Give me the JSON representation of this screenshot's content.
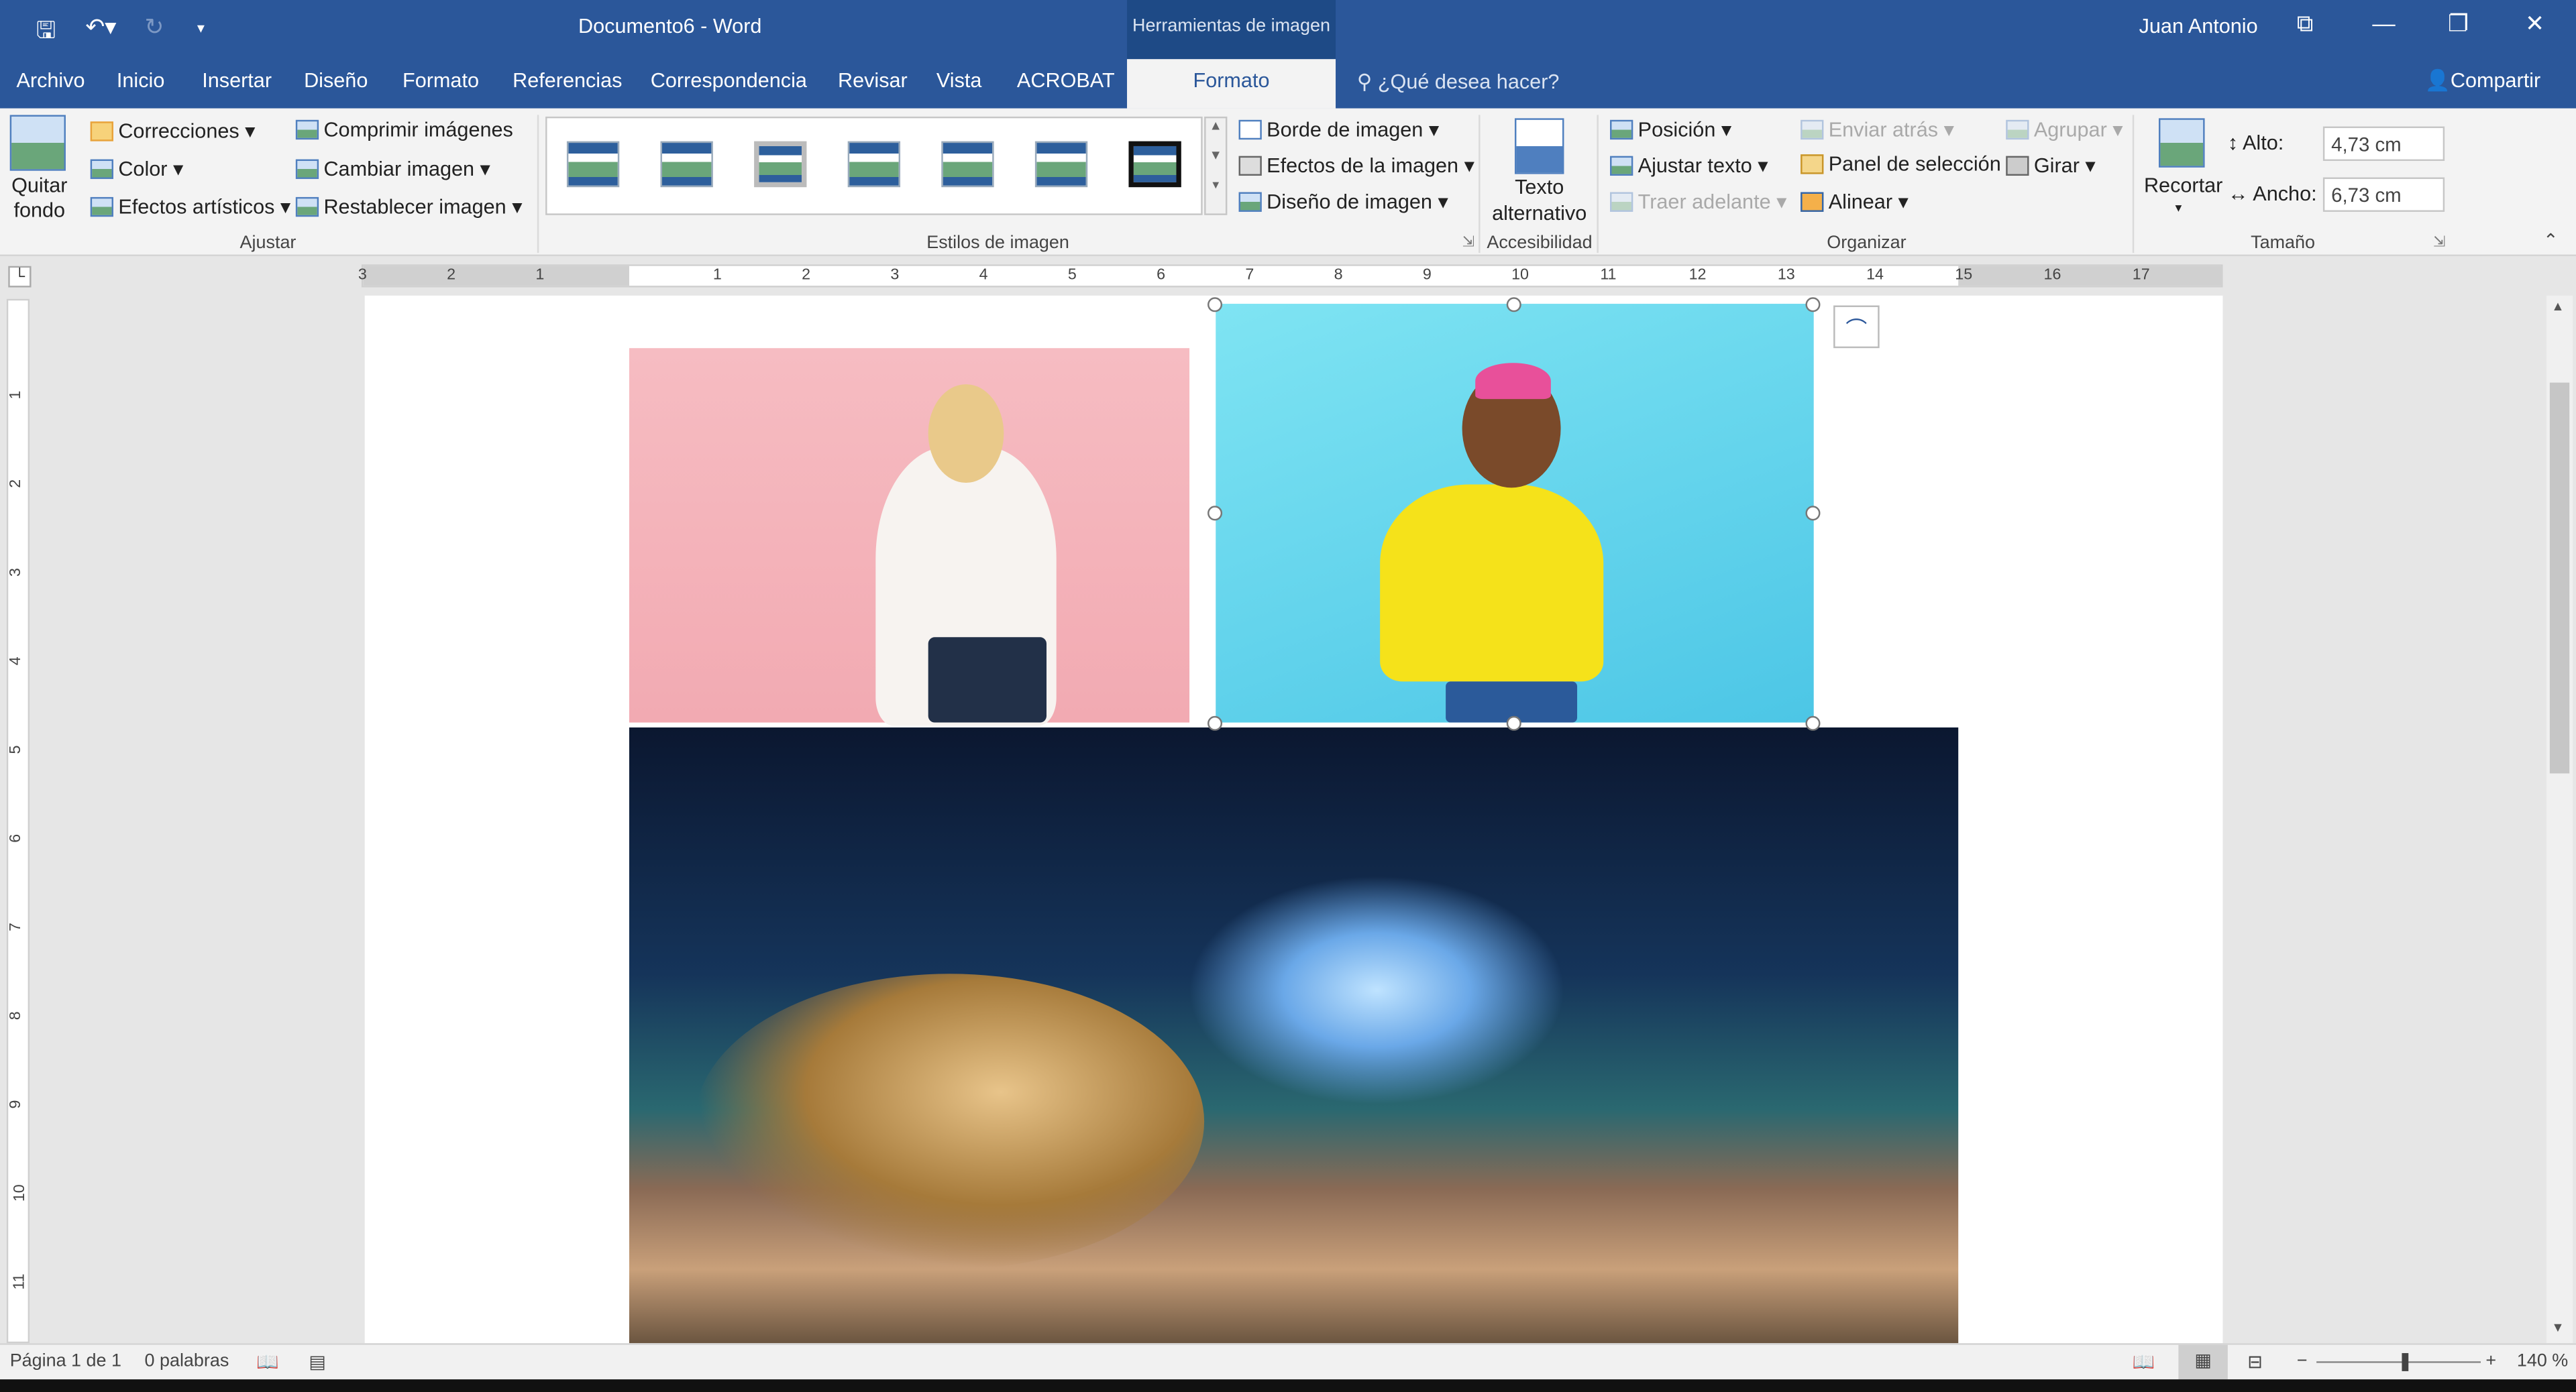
{
  "titlebar": {
    "document_title": "Documento6 - Word",
    "context_tools": "Herramientas de imagen",
    "user": "Juan Antonio"
  },
  "tabs": [
    "Archivo",
    "Inicio",
    "Insertar",
    "Diseño",
    "Formato",
    "Referencias",
    "Correspondencia",
    "Revisar",
    "Vista",
    "ACROBAT"
  ],
  "active_tab": "Formato",
  "search_placeholder": "¿Qué desea hacer?",
  "share_label": "Compartir",
  "ribbon": {
    "ajustar": {
      "quitar_fondo": "Quitar fondo",
      "correcciones": "Correcciones ▾",
      "color": "Color ▾",
      "efectos": "Efectos artísticos ▾",
      "comprimir": "Comprimir imágenes",
      "cambiar": "Cambiar imagen ▾",
      "restablecer": "Restablecer imagen ▾",
      "label": "Ajustar"
    },
    "estilos": {
      "borde": "Borde de imagen ▾",
      "efectos": "Efectos de la imagen ▾",
      "diseno": "Diseño de imagen ▾",
      "label": "Estilos de imagen"
    },
    "accesibilidad": {
      "texto_alt": "Texto alternativo",
      "label": "Accesibilidad"
    },
    "organizar": {
      "posicion": "Posición ▾",
      "ajustar_texto": "Ajustar texto ▾",
      "traer": "Traer adelante ▾",
      "enviar": "Enviar atrás ▾",
      "panel": "Panel de selección",
      "alinear": "Alinear ▾",
      "agrupar": "Agrupar ▾",
      "girar": "Girar ▾",
      "label": "Organizar"
    },
    "tamano": {
      "recortar": "Recortar",
      "alto_label": "Alto:",
      "alto_value": "4,73 cm",
      "ancho_label": "Ancho:",
      "ancho_value": "6,73 cm",
      "label": "Tamaño"
    }
  },
  "ruler": {
    "h": [
      "3",
      "2",
      "1",
      "1",
      "2",
      "3",
      "4",
      "5",
      "6",
      "7",
      "8",
      "9",
      "10",
      "11",
      "12",
      "13",
      "14",
      "15",
      "16",
      "17"
    ],
    "v": [
      "1",
      "2",
      "3",
      "4",
      "5",
      "6",
      "7",
      "8",
      "9",
      "10",
      "11"
    ]
  },
  "status": {
    "page": "Página 1 de 1",
    "words": "0 palabras",
    "zoom": "140 %",
    "zoom_level_percent": 140
  },
  "colors": {
    "brand": "#2b579a"
  }
}
